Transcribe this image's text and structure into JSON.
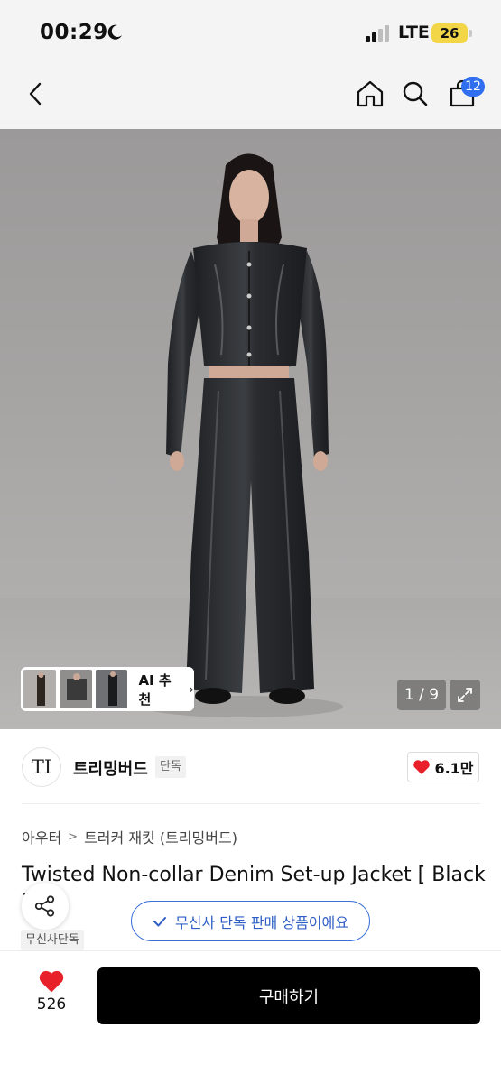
{
  "status_bar": {
    "time": "00:29",
    "network": "LTE",
    "battery": "26"
  },
  "nav": {
    "cart_count": "12"
  },
  "gallery": {
    "ai_label": "AI 추천",
    "counter": "1 / 9"
  },
  "brand": {
    "logo_text": "TI",
    "name": "트리밍버드",
    "tag": "단독",
    "likes": "6.1만"
  },
  "breadcrumb": [
    "아우터",
    "트러커 재킷 (트리밍버드)"
  ],
  "product": {
    "title": "Twisted Non-collar Denim Set-up Jacket [ Black ]",
    "exclusive_banner": "무신사 단독 판매 상품이에요",
    "musinsa_tag": "무신사단독"
  },
  "bottom": {
    "wish_count": "526",
    "buy_label": "구매하기"
  },
  "colors": {
    "accent_blue": "#2f6ff0",
    "heart_red": "#e8202a",
    "buy_button": "#000000"
  },
  "icons": [
    "moon-icon",
    "signal-icon",
    "back-icon",
    "home-icon",
    "search-icon",
    "cart-icon",
    "expand-icon",
    "heart-icon",
    "share-icon",
    "check-icon"
  ]
}
